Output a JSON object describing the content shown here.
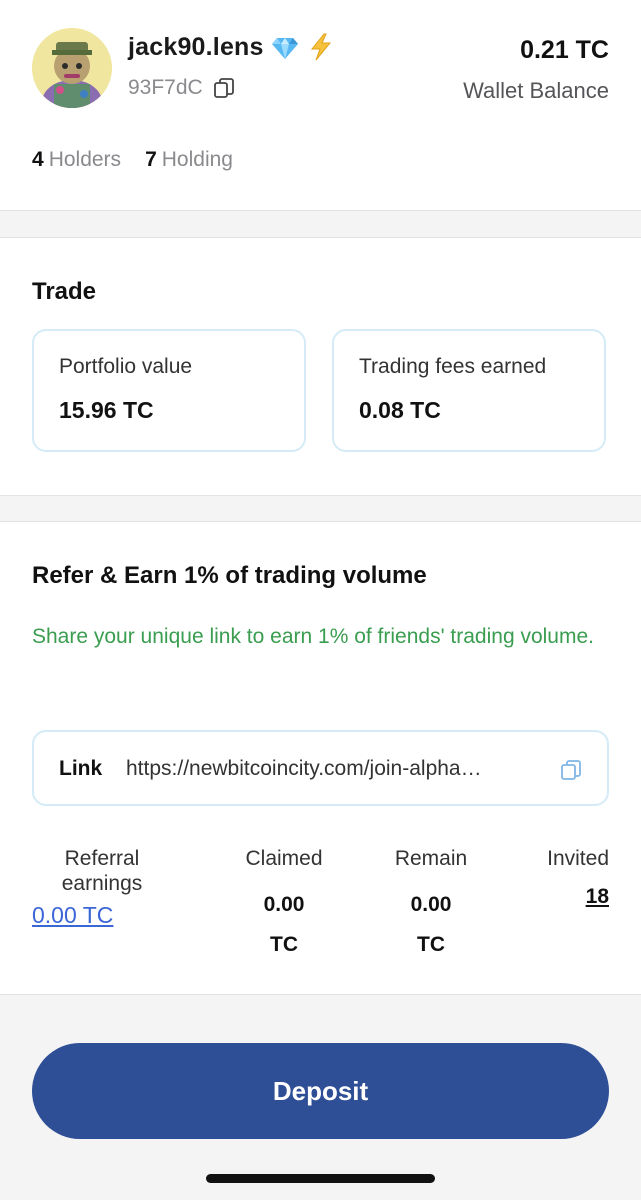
{
  "profile": {
    "username": "jack90.lens",
    "address": "93F7dC",
    "badges": [
      "diamond-icon",
      "lightning-icon"
    ],
    "avatar": "avatar",
    "wallet_balance_value": "0.21 TC",
    "wallet_balance_label": "Wallet Balance",
    "holders_count": "4",
    "holders_label": "Holders",
    "holding_count": "7",
    "holding_label": "Holding"
  },
  "trade": {
    "title": "Trade",
    "portfolio_label": "Portfolio value",
    "portfolio_value": "15.96 TC",
    "fees_label": "Trading fees earned",
    "fees_value": "0.08 TC"
  },
  "referral": {
    "title": "Refer & Earn 1% of trading volume",
    "description": "Share your unique link to earn 1% of friends' trading volume.",
    "link_label": "Link",
    "link_url": "https://newbitcoincity.com/join-alpha…",
    "stats": {
      "referral_earnings_label": "Referral earnings",
      "referral_earnings_value": "0.00 TC",
      "claimed_label": "Claimed",
      "claimed_value": "0.00 TC",
      "remain_label": "Remain",
      "remain_value": "0.00 TC",
      "invited_label": "Invited",
      "invited_value": "18"
    }
  },
  "actions": {
    "deposit_label": "Deposit"
  },
  "colors": {
    "accent_button": "#2e4e96",
    "link_blue": "#3a66d6",
    "success_green": "#3a9d50",
    "card_border": "#d5ebf7"
  }
}
